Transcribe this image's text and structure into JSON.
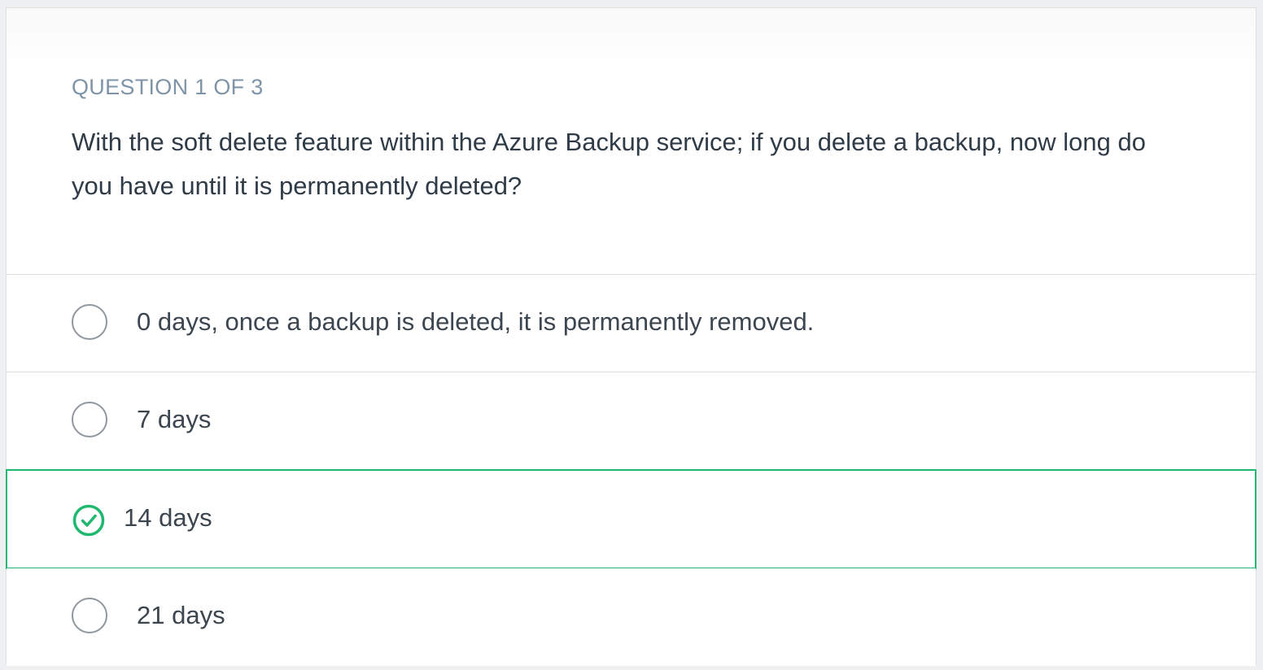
{
  "question": {
    "counter": "QUESTION 1 OF 3",
    "text": "With the soft delete feature within the Azure Backup service; if you delete a backup, now long do you have until it is permanently deleted?"
  },
  "options": [
    {
      "label": "0 days, once a backup is deleted, it is permanently removed.",
      "state": "unselected"
    },
    {
      "label": "7 days",
      "state": "unselected"
    },
    {
      "label": "14 days",
      "state": "correct"
    },
    {
      "label": "21 days",
      "state": "unselected"
    }
  ],
  "colors": {
    "correct": "#1fb870",
    "counter": "#7f94a6",
    "text": "#2f3b47"
  },
  "icons": {
    "unselected": "radio-circle-icon",
    "correct": "check-circle-icon"
  }
}
